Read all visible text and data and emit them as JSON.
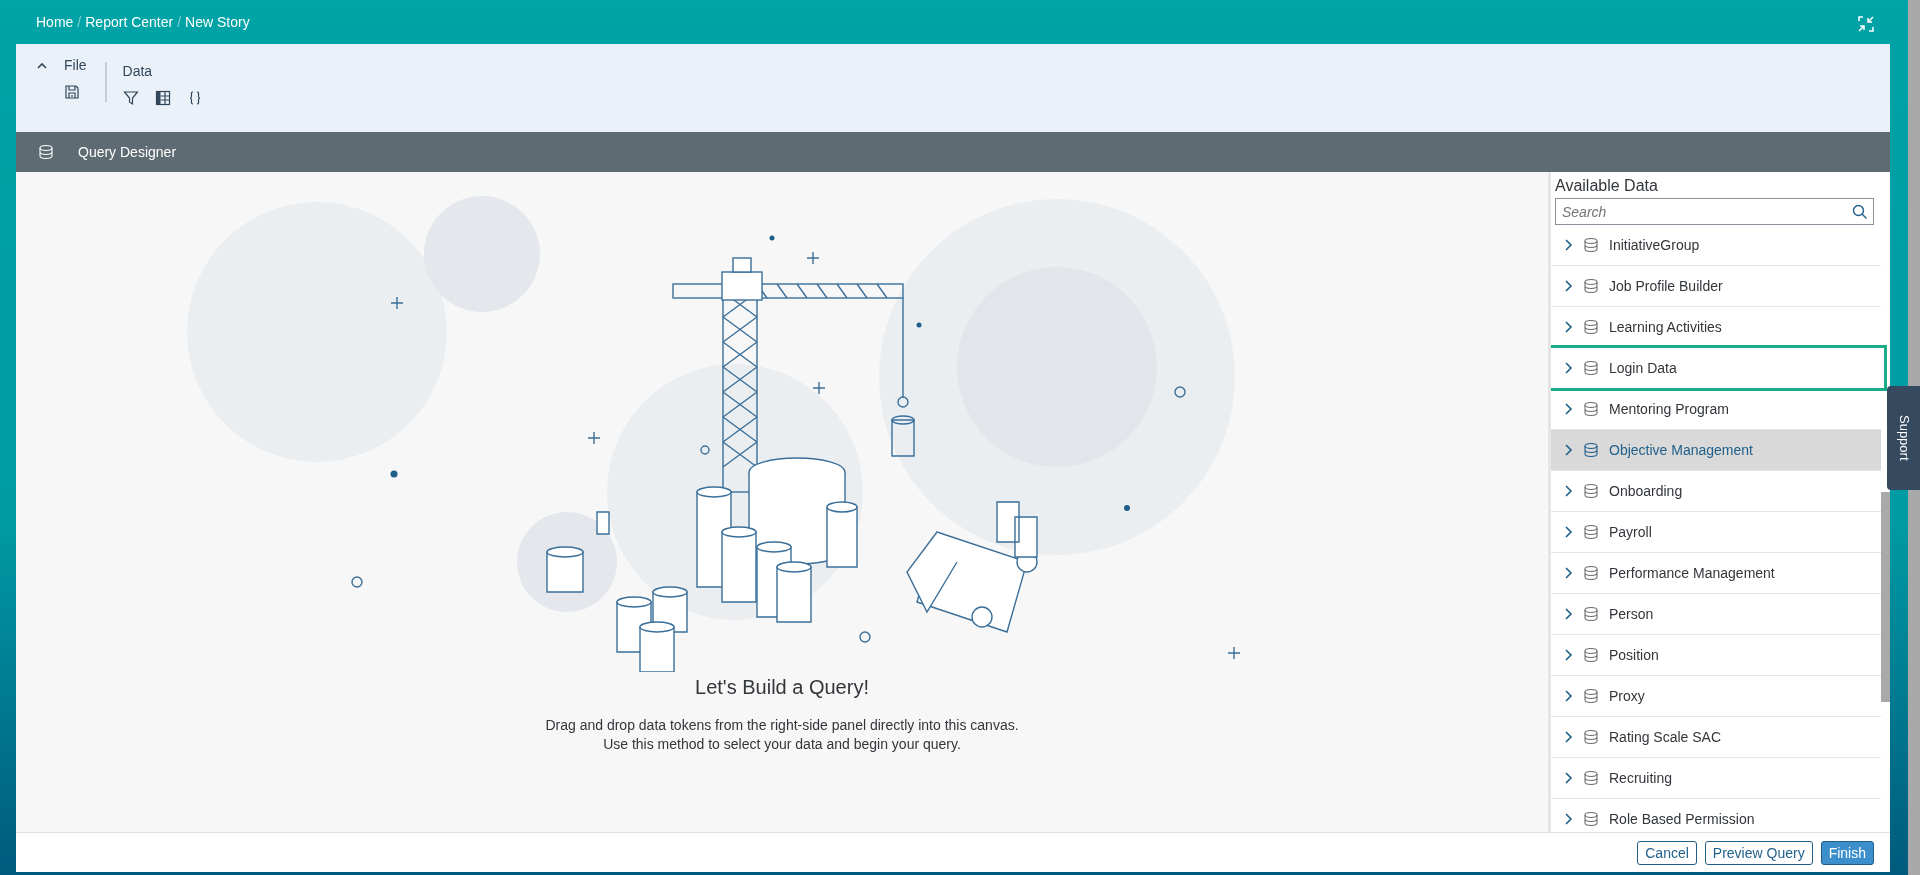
{
  "breadcrumb": [
    {
      "kind": "link",
      "text": "Home"
    },
    {
      "kind": "sep",
      "text": "/"
    },
    {
      "kind": "link",
      "text": "Report Center"
    },
    {
      "kind": "sep",
      "text": "/"
    },
    {
      "kind": "link",
      "text": "New Story"
    }
  ],
  "toolbar": {
    "collapsible": true,
    "groups": [
      {
        "label": "File",
        "tools": [
          {
            "kind": "save"
          }
        ]
      },
      {
        "label": "Data",
        "tools": [
          {
            "kind": "filter"
          },
          {
            "kind": "table"
          },
          {
            "kind": "braces"
          }
        ]
      }
    ]
  },
  "designer_bar": {
    "title": "Query Designer"
  },
  "canvas": {
    "heading": "Let's Build a Query!",
    "text": "Drag and drop data tokens from the right-side panel directly into this canvas. Use this method to select your data and begin your query."
  },
  "panel": {
    "title": "Available Data",
    "search": {
      "placeholder": "Search"
    },
    "items": [
      {
        "label": "InitiativeGroup",
        "selected": false,
        "highlighted": false
      },
      {
        "label": "Job Profile Builder",
        "selected": false,
        "highlighted": false
      },
      {
        "label": "Learning Activities",
        "selected": false,
        "highlighted": false
      },
      {
        "label": "Login Data",
        "selected": false,
        "highlighted": true
      },
      {
        "label": "Mentoring Program",
        "selected": false,
        "highlighted": false
      },
      {
        "label": "Objective Management",
        "selected": true,
        "highlighted": false
      },
      {
        "label": "Onboarding",
        "selected": false,
        "highlighted": false
      },
      {
        "label": "Payroll",
        "selected": false,
        "highlighted": false
      },
      {
        "label": "Performance Management",
        "selected": false,
        "highlighted": false
      },
      {
        "label": "Person",
        "selected": false,
        "highlighted": false
      },
      {
        "label": "Position",
        "selected": false,
        "highlighted": false
      },
      {
        "label": "Proxy",
        "selected": false,
        "highlighted": false
      },
      {
        "label": "Rating Scale SAC",
        "selected": false,
        "highlighted": false
      },
      {
        "label": "Recruiting",
        "selected": false,
        "highlighted": false
      },
      {
        "label": "Role Based Permission",
        "selected": false,
        "highlighted": false
      }
    ]
  },
  "support_tab": {
    "label": "Support"
  },
  "footer": {
    "buttons": [
      {
        "label": "Cancel",
        "kind": "secondary"
      },
      {
        "label": "Preview Query",
        "kind": "secondary"
      },
      {
        "label": "Finish",
        "kind": "primary"
      }
    ]
  }
}
